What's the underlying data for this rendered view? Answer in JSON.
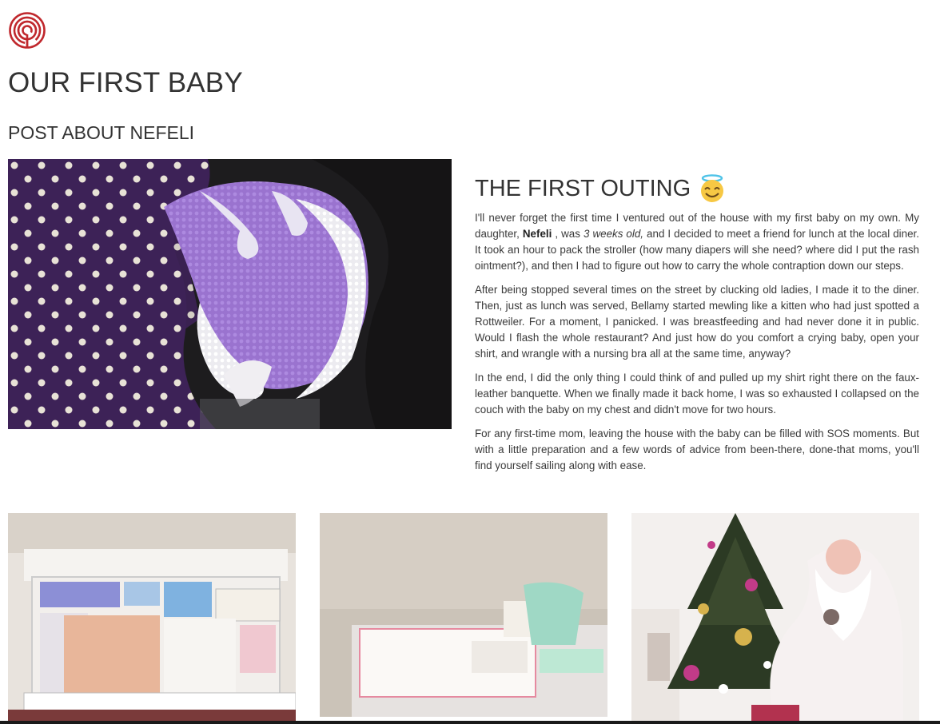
{
  "header": {
    "logo_icon": "spiral-logo-icon",
    "brand_color": "#c0282d",
    "title": "OUR FIRST BABY",
    "subtitle": "POST ABOUT NEFELI"
  },
  "hero": {
    "image": "crocheted-baby-booties-photo"
  },
  "article": {
    "title": "THE FIRST OUTING",
    "title_icon": "smiling-face-with-halo-icon",
    "p1_a": "I'll never forget the first time I ventured out of the house with my first baby on my own. My daughter, ",
    "p1_name": "Nefeli",
    "p1_b": " , was ",
    "p1_age": "3 weeks old,",
    "p1_c": " and I decided to meet a friend for lunch at the local diner. It took an hour to pack the stroller (how many diapers will she need? where did I put the rash ointment?), and then I had to figure out how to carry the whole contraption down our steps.",
    "p2": "After being stopped several times on the street by clucking old ladies, I made it to the diner. Then, just as lunch was served, Bellamy started mewling like a kitten who had just spotted a Rottweiler. For a moment, I panicked. I was breastfeeding and had never done it in public. Would I flash the whole restaurant? And just how do you comfort a crying baby, open your shirt, and wrangle with a nursing bra all at the same time, anyway?",
    "p3": "In the end, I did the only thing I could think of and pulled up my shirt right there on the faux-leather banquette. When we finally made it back home, I was so exhausted I collapsed on the couch with the baby on my chest and didn't move for two hours.",
    "p4": "For any first-time mom, leaving the house with the baby can be filled with SOS moments. But with a little preparation and a few words of advice from been-there, done-that moms, you'll find yourself sailing along with ease."
  },
  "gallery": [
    {
      "image": "diaper-drawer-photo"
    },
    {
      "image": "changing-table-photo"
    },
    {
      "image": "christmas-tree-santa-photo"
    }
  ]
}
